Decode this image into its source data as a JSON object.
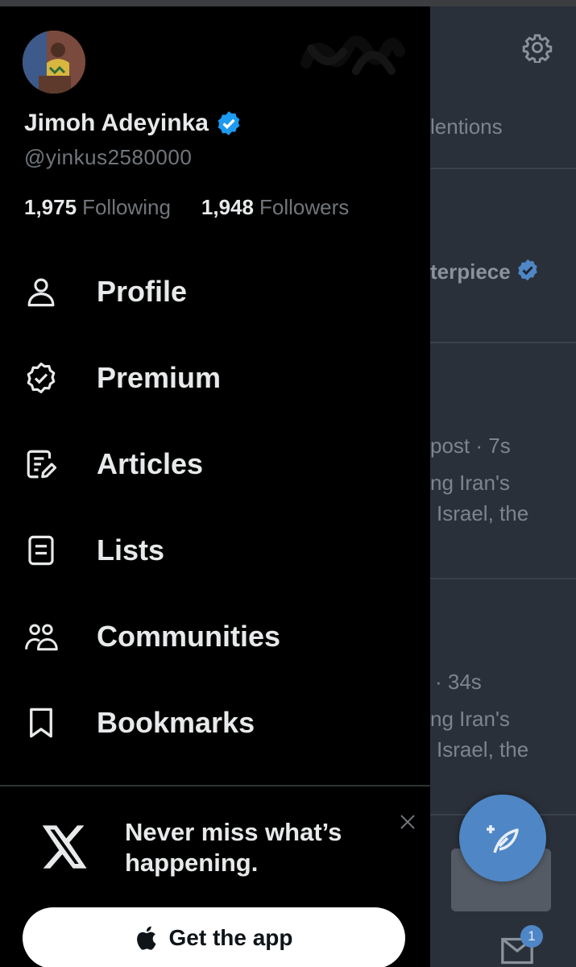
{
  "profile": {
    "name": "Jimoh Adeyinka",
    "handle": "@yinkus2580000",
    "following_count": "1,975",
    "following_label": "Following",
    "followers_count": "1,948",
    "followers_label": "Followers"
  },
  "menu": {
    "items": [
      {
        "label": "Profile",
        "icon": "person-icon"
      },
      {
        "label": "Premium",
        "icon": "verified-badge-icon"
      },
      {
        "label": "Articles",
        "icon": "article-edit-icon"
      },
      {
        "label": "Lists",
        "icon": "list-icon"
      },
      {
        "label": "Communities",
        "icon": "communities-icon"
      },
      {
        "label": "Bookmarks",
        "icon": "bookmark-icon"
      }
    ]
  },
  "promo": {
    "message": "Never miss what’s happening.",
    "button_label": "Get the app"
  },
  "background_timeline": {
    "tab_partial": "lentions",
    "post1_partial": "terpiece",
    "post2_meta": "post · 7s",
    "post2_line1": "ng Iran's",
    "post2_line2": "Israel, the",
    "post3_meta": "· 34s",
    "post3_line1": "ng Iran's",
    "post3_line2": "Israel, the",
    "mail_badge": "1"
  },
  "colors": {
    "accent": "#1d9bf0",
    "background": "#000000",
    "muted_text": "#71767b",
    "fab": "#4f86c6"
  }
}
